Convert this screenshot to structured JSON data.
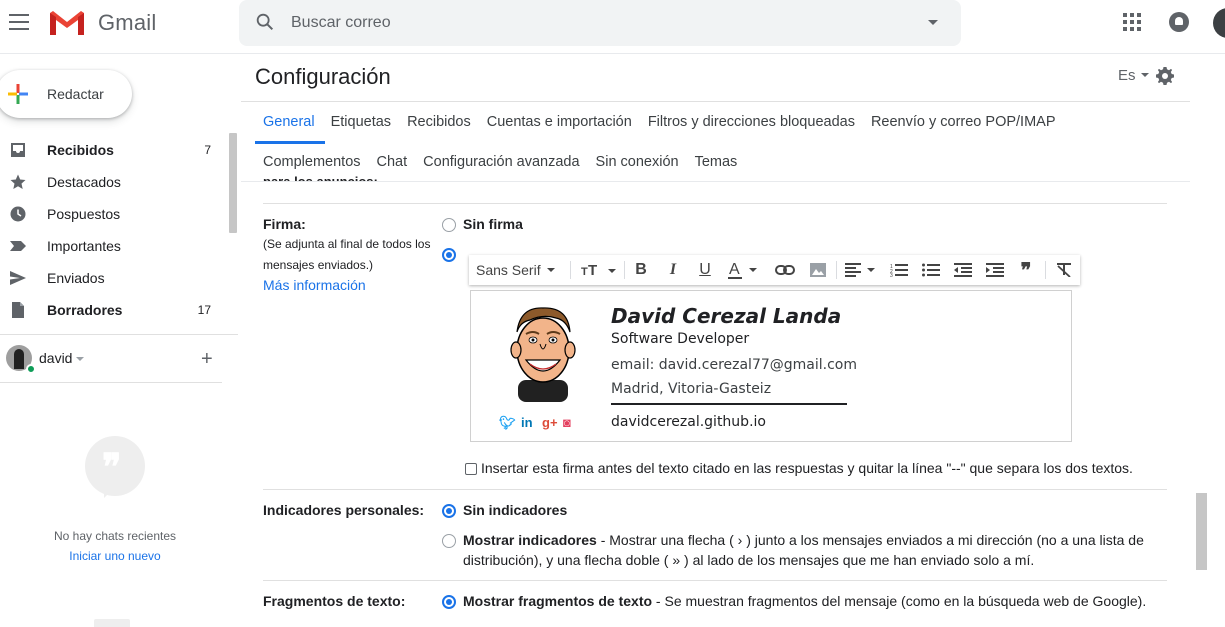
{
  "app": {
    "name": "Gmail"
  },
  "search": {
    "placeholder": "Buscar correo"
  },
  "compose": {
    "label": "Redactar"
  },
  "sidebar": {
    "items": [
      {
        "label": "Recibidos",
        "count": "7",
        "icon": "inbox-icon",
        "bold": true
      },
      {
        "label": "Destacados",
        "count": "",
        "icon": "star-icon",
        "bold": false
      },
      {
        "label": "Pospuestos",
        "count": "",
        "icon": "clock-icon",
        "bold": false
      },
      {
        "label": "Importantes",
        "count": "",
        "icon": "label-important-icon",
        "bold": false
      },
      {
        "label": "Enviados",
        "count": "",
        "icon": "send-icon",
        "bold": false
      },
      {
        "label": "Borradores",
        "count": "17",
        "icon": "draft-icon",
        "bold": true
      }
    ]
  },
  "hangouts": {
    "user": "david",
    "no_chats": "No hay chats recientes",
    "start_new": "Iniciar uno nuevo"
  },
  "settings": {
    "title": "Configuración",
    "lang": "Es",
    "tabs_row1": [
      "General",
      "Etiquetas",
      "Recibidos",
      "Cuentas e importación",
      "Filtros y direcciones bloqueadas",
      "Reenvío y correo POP/IMAP"
    ],
    "tabs_row2": [
      "Complementos",
      "Chat",
      "Configuración avanzada",
      "Sin conexión",
      "Temas"
    ],
    "active_tab": "General",
    "partial_label": "para los anuncios:",
    "signature": {
      "label": "Firma:",
      "sub": "(Se adjunta al final de todos los mensajes enviados.)",
      "more": "Más información",
      "option_none": "Sin firma",
      "font": "Sans Serif",
      "name": "David Cerezal Landa",
      "role": "Software Developer",
      "email": "email: david.cerezal77@gmail.com",
      "city": "Madrid, Vitoria-Gasteiz",
      "web": "davidcerezal.github.io",
      "insert_before": "Insertar esta firma antes del texto citado en las respuestas y quitar la línea \"--\" que separa los dos textos."
    },
    "indicators": {
      "label": "Indicadores personales:",
      "none": "Sin indicadores",
      "show": "Mostrar indicadores",
      "show_desc_1": " - Mostrar una flecha ( › ) junto a los mensajes enviados a mi dirección (no a una lista de",
      "show_desc_2": "distribución), y una flecha doble ( » ) al lado de los mensajes que me han enviado solo a mí."
    },
    "snippets": {
      "label": "Fragmentos de texto:",
      "show": "Mostrar fragmentos de texto",
      "show_desc": " - Se muestran fragmentos del mensaje (como en la búsqueda web de Google)."
    }
  },
  "colors": {
    "accent": "#1a73e8",
    "gmail_red": "#ea4335"
  }
}
